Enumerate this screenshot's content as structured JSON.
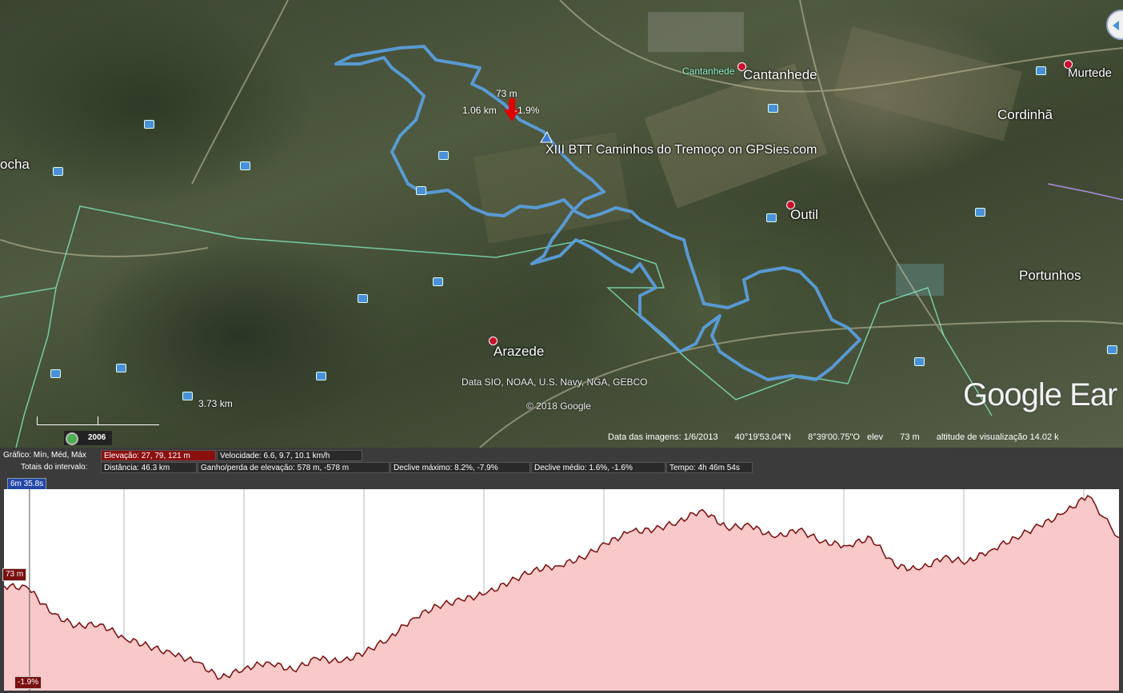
{
  "map": {
    "places": [
      {
        "name": "Cantanhede",
        "kind": "town"
      },
      {
        "name": "Cantanhede",
        "kind": "area"
      },
      {
        "name": "Murtede",
        "kind": "town"
      },
      {
        "name": "Cordinhã",
        "kind": "town"
      },
      {
        "name": "Outil",
        "kind": "town"
      },
      {
        "name": "Portunhos",
        "kind": "town"
      },
      {
        "name": "Arazede",
        "kind": "town"
      },
      {
        "name": "ocha",
        "kind": "town"
      }
    ],
    "track_title": "XIII BTT Caminhos do Tremoço on GPSies.com",
    "cursor_elevation": "73 m",
    "cursor_distance": "1.06 km",
    "cursor_slope": "-1.9%",
    "scale_label": "3.73 km",
    "attribution_data": "Data SIO, NOAA, U.S. Navy, NGA, GEBCO",
    "attribution_copyright": "© 2018 Google",
    "logo": "Google Ear",
    "year": "2006",
    "status": {
      "imagery_date": "Data das imagens: 1/6/2013",
      "lat": "40°19'53.04\"N",
      "lon": "8°39'00.75\"O",
      "elev_label": "elev",
      "elev_value": "73 m",
      "eye_alt": "altitude de visualização  14.02 k"
    },
    "track_color": "#5a9fe0",
    "boundary_color": "#7fe0b8"
  },
  "profile": {
    "row1": {
      "label": "Gráfico: Mín, Méd, Máx",
      "elevation": "Elevação: 27, 79, 121 m",
      "speed": "Velocidade: 6.6, 9.7, 10.1 km/h"
    },
    "row2": {
      "label": "Totais do intervalo:",
      "distance": "Distância: 46.3 km",
      "gain_loss": "Ganho/perda de elevação: 578 m, -578 m",
      "max_slope": "Declive máximo: 8.2%, -7.9%",
      "avg_slope": "Declive médio: 1.6%, -1.6%",
      "time": "Tempo: 4h 46m 54s"
    },
    "time_badge": "6m 35.8s",
    "cursor_tag": "73 m",
    "slope_tag": "-1.9%",
    "fill_color": "#f9c9c9",
    "line_color": "#7a0a0a"
  },
  "chart_data": {
    "type": "area",
    "title": "",
    "xlabel": "",
    "ylabel": "",
    "x_unit": "km",
    "y_unit": "m",
    "xlim": [
      0,
      46.3
    ],
    "ylim": [
      27,
      121
    ],
    "x": [
      0,
      1,
      2,
      3,
      4,
      5,
      6,
      7,
      8,
      9,
      10,
      11,
      12,
      13,
      14,
      15,
      16,
      17,
      18,
      19,
      20,
      21,
      22,
      23,
      24,
      25,
      26,
      27,
      28,
      29,
      30,
      31,
      32,
      33,
      34,
      35,
      36,
      37,
      38,
      39,
      40,
      41,
      42,
      43,
      44,
      45,
      46.3
    ],
    "series": [
      {
        "values": [
          76,
          75,
          62,
          56,
          57,
          50,
          46,
          42,
          38,
          30,
          35,
          38,
          34,
          40,
          38,
          43,
          50,
          60,
          66,
          69,
          72,
          78,
          84,
          86,
          90,
          97,
          103,
          104,
          108,
          114,
          105,
          106,
          100,
          104,
          98,
          96,
          100,
          86,
          84,
          90,
          88,
          94,
          100,
          106,
          112,
          121,
          100
        ]
      }
    ]
  }
}
